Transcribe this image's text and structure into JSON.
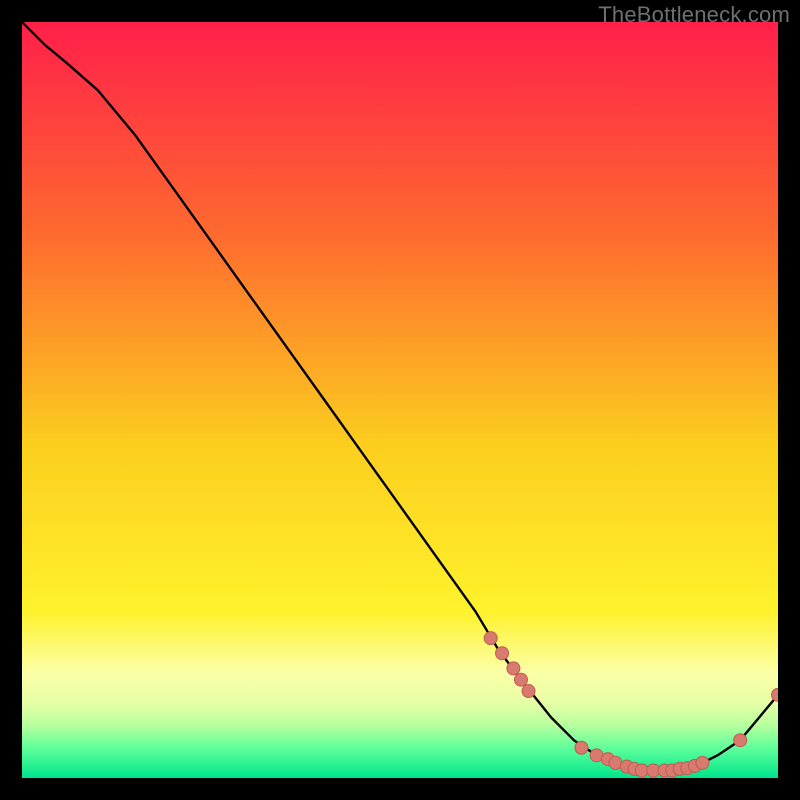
{
  "watermark": "TheBottleneck.com",
  "colors": {
    "black": "#000000",
    "curve": "#000000",
    "marker_fill": "#d87a6f",
    "marker_stroke": "#c05b4f"
  },
  "chart_data": {
    "type": "line",
    "title": "",
    "xlabel": "",
    "ylabel": "",
    "xlim": [
      0,
      100
    ],
    "ylim": [
      0,
      100
    ],
    "grid": false,
    "legend": false,
    "series": [
      {
        "name": "bottleneck-curve",
        "x": [
          0,
          3,
          6,
          10,
          15,
          20,
          25,
          30,
          35,
          40,
          45,
          50,
          55,
          60,
          63,
          66,
          70,
          73,
          76,
          80,
          83,
          86,
          89,
          92,
          95,
          100
        ],
        "y": [
          100,
          97,
          94.5,
          91,
          85,
          78,
          71,
          64,
          57,
          50,
          43,
          36,
          29,
          22,
          17,
          13,
          8,
          5,
          3,
          1.5,
          1,
          1,
          1.5,
          3,
          5,
          11
        ]
      }
    ],
    "markers": {
      "name": "highlight-points",
      "x": [
        62,
        63.5,
        65,
        66,
        67,
        74,
        76,
        77.5,
        78.5,
        80,
        81,
        82,
        83.5,
        85,
        86,
        87,
        88,
        89,
        90,
        95,
        100
      ],
      "y": [
        18.5,
        16.5,
        14.5,
        13,
        11.5,
        4,
        3,
        2.5,
        2,
        1.5,
        1.2,
        1,
        1,
        1,
        1,
        1.2,
        1.3,
        1.6,
        2,
        5,
        11
      ]
    },
    "background_bands": [
      {
        "y0": 100,
        "y1": 72,
        "top": "#ff1f4a",
        "bottom": "#fe6a2f"
      },
      {
        "y0": 72,
        "y1": 44,
        "top": "#fe6a2f",
        "bottom": "#fcce1e"
      },
      {
        "y0": 44,
        "y1": 22,
        "top": "#fcce1e",
        "bottom": "#fff22c"
      },
      {
        "y0": 22,
        "y1": 14,
        "top": "#fff22c",
        "bottom": "#fbffa7"
      },
      {
        "y0": 14,
        "y1": 10,
        "top": "#fbffa7",
        "bottom": "#e7ffa7"
      },
      {
        "y0": 10,
        "y1": 7,
        "top": "#e7ffa7",
        "bottom": "#b7ff9d"
      },
      {
        "y0": 7,
        "y1": 4,
        "top": "#b7ff9d",
        "bottom": "#5fff9a"
      },
      {
        "y0": 4,
        "y1": 0,
        "top": "#5fff9a",
        "bottom": "#00e58c"
      }
    ]
  }
}
